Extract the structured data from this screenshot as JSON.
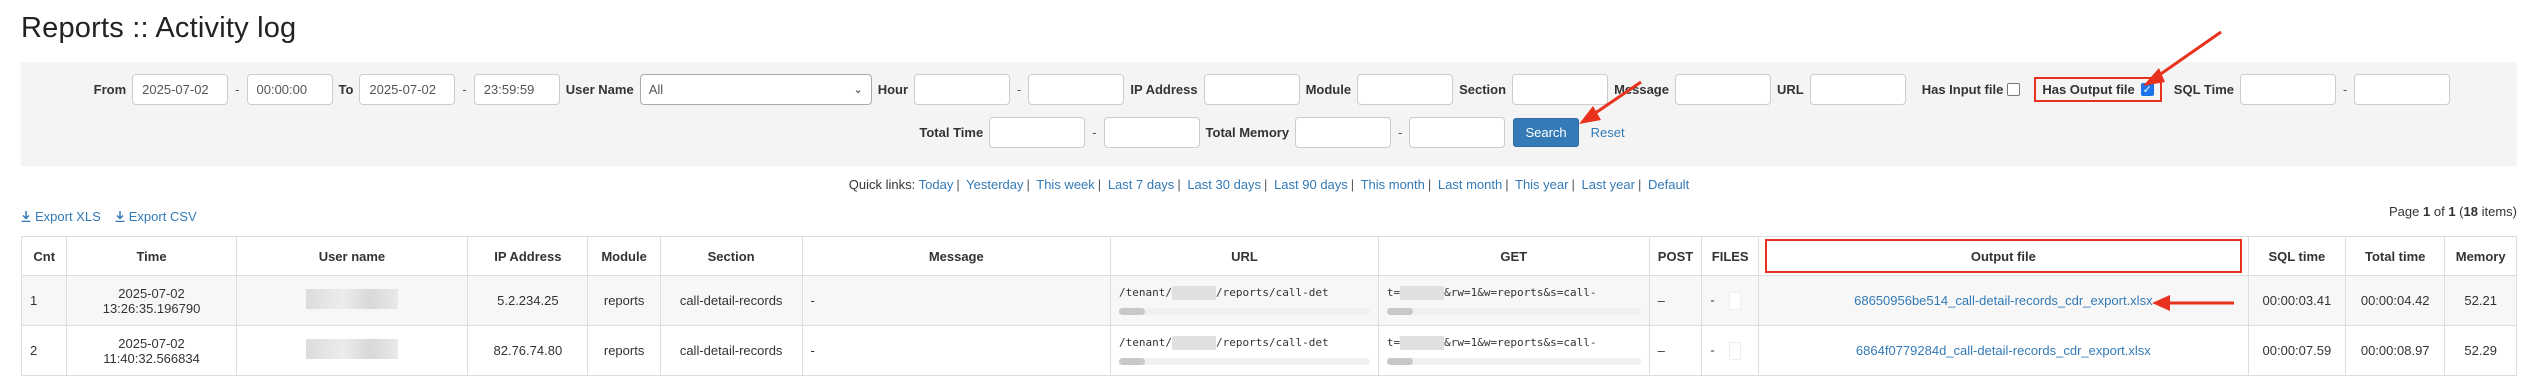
{
  "page": {
    "title": "Reports :: Activity log"
  },
  "filters": {
    "from_label": "From",
    "from_date": "2025-07-02",
    "from_time": "00:00:00",
    "to_label": "To",
    "to_date": "2025-07-02",
    "to_time": "23:59:59",
    "username_label": "User Name",
    "username_value": "All",
    "hour_label": "Hour",
    "hour_from": "",
    "hour_to": "",
    "ip_label": "IP Address",
    "ip_value": "",
    "module_label": "Module",
    "module_value": "",
    "section_label": "Section",
    "section_value": "",
    "message_label": "Message",
    "message_value": "",
    "url_label": "URL",
    "url_value": "",
    "has_input_label": "Has Input file",
    "has_input_checked": false,
    "has_output_label": "Has Output file",
    "has_output_checked": true,
    "sql_time_label": "SQL Time",
    "sql_time_from": "",
    "sql_time_to": "",
    "total_time_label": "Total Time",
    "total_time_from": "",
    "total_time_to": "",
    "total_memory_label": "Total Memory",
    "total_memory_from": "",
    "total_memory_to": "",
    "dash": "-",
    "search_label": "Search",
    "reset_label": "Reset"
  },
  "quick_links": {
    "label": "Quick links:",
    "items": [
      "Today",
      "Yesterday",
      "This week",
      "Last 7 days",
      "Last 30 days",
      "Last 90 days",
      "This month",
      "Last month",
      "This year",
      "Last year",
      "Default"
    ]
  },
  "export": {
    "xls_label": "Export XLS",
    "csv_label": "Export CSV"
  },
  "pager": {
    "prefix": "Page",
    "current": "1",
    "of": "of",
    "total": "1",
    "count": "18",
    "suffix": "items"
  },
  "table": {
    "columns": [
      "Cnt",
      "Time",
      "User name",
      "IP Address",
      "Module",
      "Section",
      "Message",
      "URL",
      "GET",
      "POST",
      "FILES",
      "Output file",
      "SQL time",
      "Total time",
      "Memory"
    ],
    "rows": [
      {
        "cnt": "1",
        "date": "2025-07-02",
        "time": "13:26:35.196790",
        "ip": "5.2.234.25",
        "module": "reports",
        "section": "call-detail-records",
        "message": "-",
        "url_prefix": "/tenant/",
        "url_suffix": "/reports/call-det",
        "get_prefix": "t=",
        "get_suffix": "&rw=1&w=reports&s=call-",
        "post": "–",
        "files": "-",
        "output_file": "68650956be514_call-detail-records_cdr_export.xlsx",
        "sql_time": "00:00:03.41",
        "total_time": "00:00:04.42",
        "memory": "52.21"
      },
      {
        "cnt": "2",
        "date": "2025-07-02",
        "time": "11:40:32.566834",
        "ip": "82.76.74.80",
        "module": "reports",
        "section": "call-detail-records",
        "message": "-",
        "url_prefix": "/tenant/",
        "url_suffix": "/reports/call-det",
        "get_prefix": "t=",
        "get_suffix": "&rw=1&w=reports&s=call-",
        "post": "–",
        "files": "-",
        "output_file": "6864f0779284d_call-detail-records_cdr_export.xlsx",
        "sql_time": "00:00:07.59",
        "total_time": "00:00:08.97",
        "memory": "52.29"
      }
    ]
  },
  "colors": {
    "accent": "#337ab7",
    "highlight": "#e8321e",
    "panel": "#f4f4f4"
  }
}
